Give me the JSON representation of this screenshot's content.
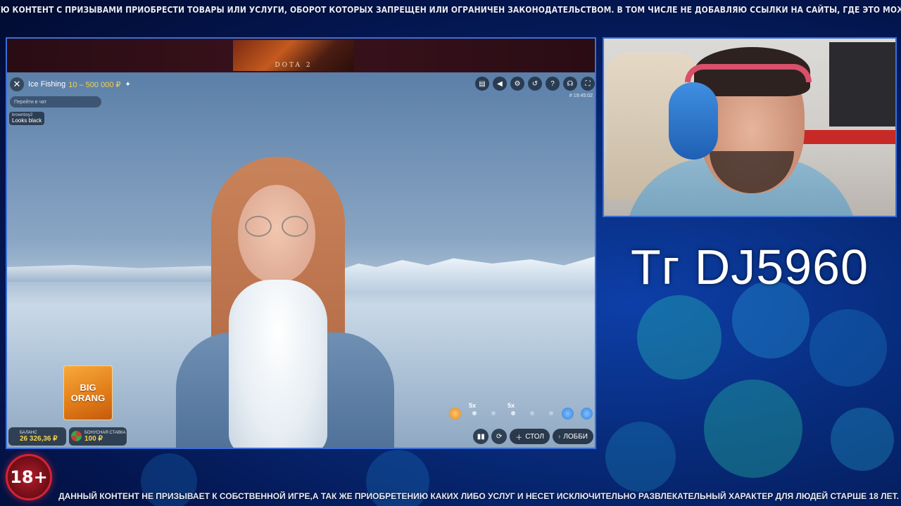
{
  "overlay": {
    "top_disclaimer": "Я НЕ ПУБЛИКУЮ КОНТЕНТ С ПРИЗЫВАМИ ПРИОБРЕСТИ ТОВАРЫ ИЛИ УСЛУГИ, ОБОРОТ КОТОРЫХ ЗАПРЕЩЕН ИЛИ ОГРАНИЧЕН ЗАКОНОДАТЕЛЬСТВОМ. В ТОМ ЧИСЛЕ НЕ ДОБАВЛЯЮ ССЫЛКИ НА САЙТЫ, ГДЕ ЭТО МОЖНО СДЕЛАТЬ!",
    "bottom_disclaimer": "ДАННЫЙ КОНТЕНТ  НЕ ПРИЗЫВАЕТ К СОБСТВЕННОЙ ИГРЕ,А ТАК ЖЕ ПРИОБРЕТЕНИЮ КАКИХ ЛИБО УСЛУГ И НЕСЕТ ИСКЛЮЧИТЕЛЬНО РАЗВЛЕКАТЕЛЬНЫЙ ХАРАКТЕР ДЛЯ ЛЮДЕЙ СТАРШЕ 18 ЛЕТ.",
    "age_badge": "18+",
    "tg_code": "Тг DJ5960"
  },
  "ad": {
    "label": "DOTA 2"
  },
  "game": {
    "title": "Ice Fishing",
    "limits": "10 – 500 000 ₽",
    "time": "# 19:45:02",
    "chat_placeholder": "Перейти в чат",
    "chat_message": {
      "user": "brownboy2",
      "text": "Looks black"
    },
    "promo_tile": {
      "line1": "BIG",
      "line2": "ORANG"
    },
    "multipliers": [
      "5x",
      "5x"
    ],
    "balance": {
      "label": "БАЛАНС",
      "value": "26 326,36 ₽"
    },
    "bonus_bet": {
      "label": "БОНУСНАЯ СТАВКА",
      "value": "100 ₽"
    },
    "buttons": {
      "table": "СТОЛ",
      "lobby": "ЛОББИ"
    },
    "toolbar_icons": [
      "chat-icon",
      "volume-icon",
      "settings-icon",
      "history-icon",
      "help-icon",
      "support-icon",
      "fullscreen-icon"
    ]
  },
  "colors": {
    "accent_gold": "#f5d34a",
    "frame_blue": "#3b6fd8",
    "lobby_green": "#3fd46c"
  }
}
